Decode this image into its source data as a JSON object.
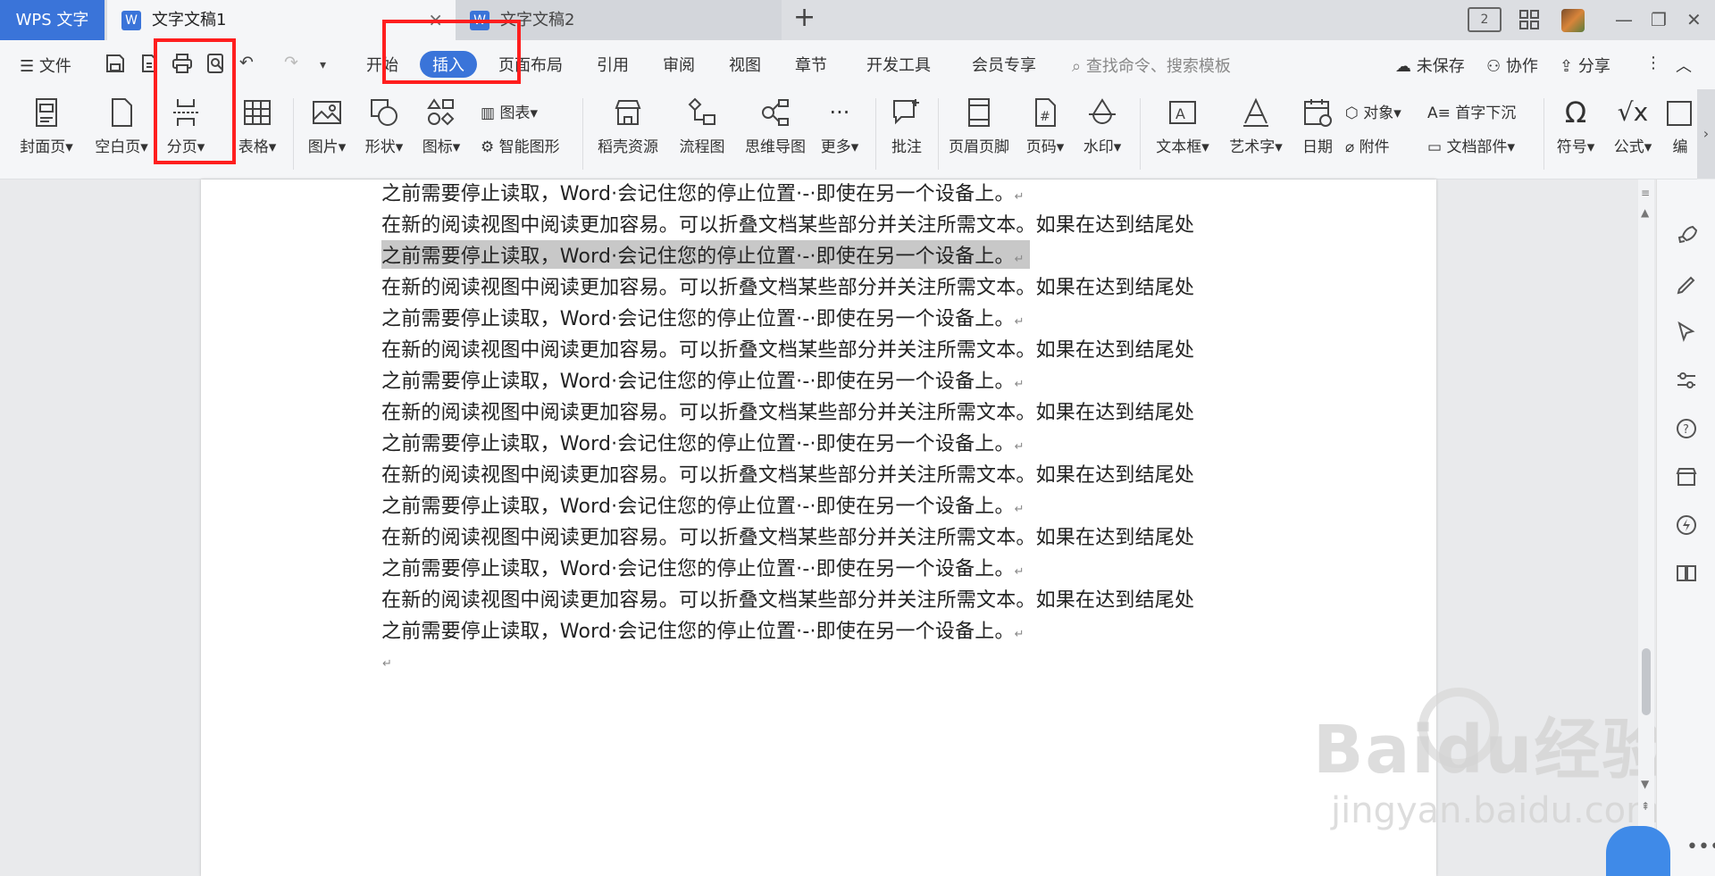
{
  "titlebar": {
    "app_tab": "WPS 文字",
    "doc_tab_active": "文字文稿1",
    "doc_tab_inactive": "文字文稿2",
    "add_tab": "+",
    "page_count_badge": "2"
  },
  "menubar": {
    "file_label": "文件",
    "tabs": [
      "开始",
      "插入",
      "页面布局",
      "引用",
      "审阅",
      "视图",
      "章节",
      "开发工具",
      "会员专享"
    ],
    "active_tab": "插入",
    "search_placeholder": "查找命令、搜索模板",
    "unsaved": "未保存",
    "collaborate": "协作",
    "share": "分享"
  },
  "ribbon": {
    "items": {
      "cover": "封面页",
      "blank": "空白页",
      "pagebreak": "分页",
      "table": "表格",
      "picture": "图片",
      "shape": "形状",
      "icon": "图标",
      "chart": "图表",
      "smartart": "智能图形",
      "resources": "稻壳资源",
      "flowchart": "流程图",
      "mindmap": "思维导图",
      "more": "更多",
      "comment": "批注",
      "header_footer": "页眉页脚",
      "page_number": "页码",
      "watermark": "水印",
      "textbox": "文本框",
      "wordart": "艺术字",
      "date": "日期",
      "object": "对象",
      "dropcap": "首字下沉",
      "attachment": "附件",
      "docparts": "文档部件",
      "symbol": "符号",
      "formula": "公式",
      "edit": "编"
    }
  },
  "document": {
    "line_a": "之前需要停止读取，Word·会记住您的停止位置·-·即使在另一个设备上。",
    "line_b": "在新的阅读视图中阅读更加容易。可以折叠文档某些部分并关注所需文本。如果在达到结尾处",
    "para_mark": "↵"
  },
  "watermark": {
    "brand": "Baidu经验",
    "url": "jingyan.baidu.com"
  },
  "colors": {
    "accent": "#3a74d9",
    "highlight_box": "#ff1e1e",
    "selection": "#c8c8c8"
  }
}
